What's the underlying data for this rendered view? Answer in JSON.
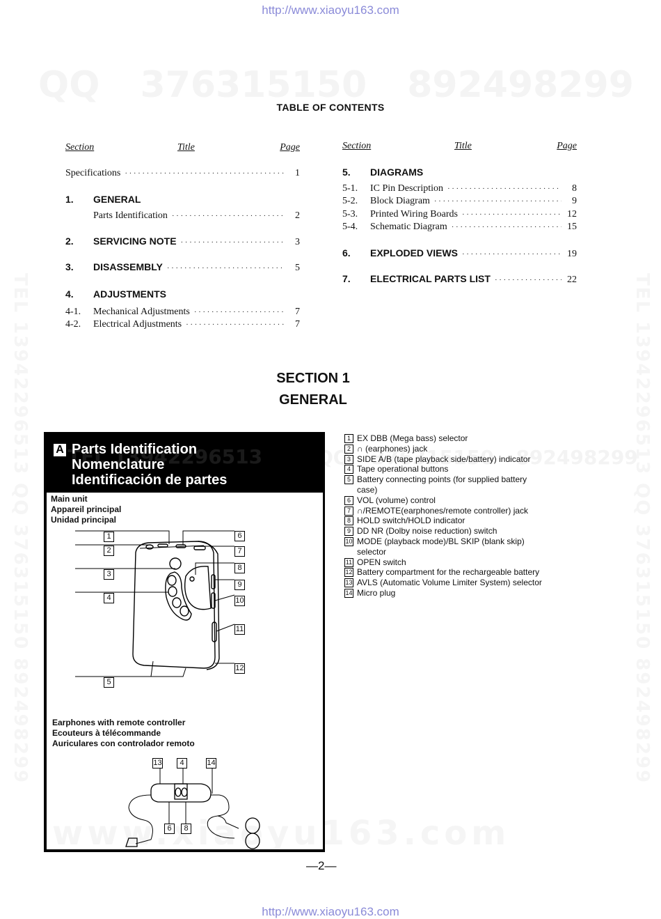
{
  "header_url": "http://www.xiaoyu163.com",
  "footer_url": "http://www.xiaoyu163.com",
  "watermarks": {
    "top": "QQ 376315150   892498299",
    "left_vertical": "TEL 13942296513  QQ 376315150  892498299",
    "right_vertical": "TEL 13942296513  QQ 376315150  892498299",
    "box_band": "TEL 13942296513",
    "right_band": "QQ 376315150  892498299",
    "bottom": "www.xiaoyu163.com"
  },
  "toc": {
    "title": "TABLE OF CONTENTS",
    "column_headers": {
      "section": "Section",
      "title": "Title",
      "page": "Page"
    },
    "left": [
      {
        "num": "",
        "title": "Specifications",
        "page": "1",
        "bold": false
      },
      {
        "num": "1.",
        "title": "GENERAL",
        "page": "",
        "bold": true
      },
      {
        "num": "",
        "title": "Parts Identification",
        "page": "2",
        "bold": false
      },
      {
        "num": "2.",
        "title": "SERVICING  NOTE",
        "page": "3",
        "bold": true
      },
      {
        "num": "3.",
        "title": "DISASSEMBLY",
        "page": "5",
        "bold": true
      },
      {
        "num": "4.",
        "title": "ADJUSTMENTS",
        "page": "",
        "bold": true
      },
      {
        "num": "4-1.",
        "title": "Mechanical Adjustments",
        "page": "7",
        "bold": false
      },
      {
        "num": "4-2.",
        "title": "Electrical Adjustments",
        "page": "7",
        "bold": false
      }
    ],
    "right": [
      {
        "num": "5.",
        "title": "DIAGRAMS",
        "page": "",
        "bold": true
      },
      {
        "num": "5-1.",
        "title": "IC Pin Description",
        "page": "8",
        "bold": false
      },
      {
        "num": "5-2.",
        "title": "Block Diagram",
        "page": "9",
        "bold": false
      },
      {
        "num": "5-3.",
        "title": "Printed Wiring Boards",
        "page": "12",
        "bold": false
      },
      {
        "num": "5-4.",
        "title": "Schematic Diagram",
        "page": "15",
        "bold": false
      },
      {
        "num": "6.",
        "title": "EXPLODED  VIEWS",
        "page": "19",
        "bold": true
      },
      {
        "num": "7.",
        "title": "ELECTRICAL  PARTS  LIST",
        "page": "22",
        "bold": true
      }
    ]
  },
  "section": {
    "line1": "SECTION  1",
    "line2": "GENERAL"
  },
  "parts_box": {
    "badge": "A",
    "title_lines": [
      "Parts Identification",
      "Nomenclature",
      "Identificación de partes"
    ],
    "main_unit_labels": [
      "Main unit",
      "Appareil principal",
      "Unidad principal"
    ],
    "earphones_labels": [
      "Earphones with remote controller",
      "Ecouteurs à télécommande",
      "Auriculares con controlador remoto"
    ],
    "main_callouts": [
      "1",
      "2",
      "3",
      "4",
      "5",
      "6",
      "7",
      "8",
      "9",
      "10",
      "11",
      "12"
    ],
    "remote_callouts": [
      "13",
      "4",
      "14",
      "6",
      "8"
    ]
  },
  "legend": [
    {
      "n": "1",
      "text": "EX DBB (Mega bass) selector"
    },
    {
      "n": "2",
      "text": "∩ (earphones) jack"
    },
    {
      "n": "3",
      "text": "SIDE A/B (tape playback side/battery) indicator"
    },
    {
      "n": "4",
      "text": "Tape operational buttons"
    },
    {
      "n": "5",
      "text": "Battery connecting points (for supplied battery case)"
    },
    {
      "n": "6",
      "text": "VOL (volume) control"
    },
    {
      "n": "7",
      "text": "∩/REMOTE(earphones/remote controller) jack"
    },
    {
      "n": "8",
      "text": "HOLD switch/HOLD indicator"
    },
    {
      "n": "9",
      "text": "DD NR (Dolby noise reduction) switch"
    },
    {
      "n": "10",
      "text": "MODE (playback mode)/BL SKIP (blank skip) selector"
    },
    {
      "n": "11",
      "text": "OPEN switch"
    },
    {
      "n": "12",
      "text": "Battery compartment for the rechargeable battery"
    },
    {
      "n": "13",
      "text": "AVLS (Automatic Volume Limiter System) selector"
    },
    {
      "n": "14",
      "text": "Micro plug"
    }
  ],
  "page_number": "—2—"
}
